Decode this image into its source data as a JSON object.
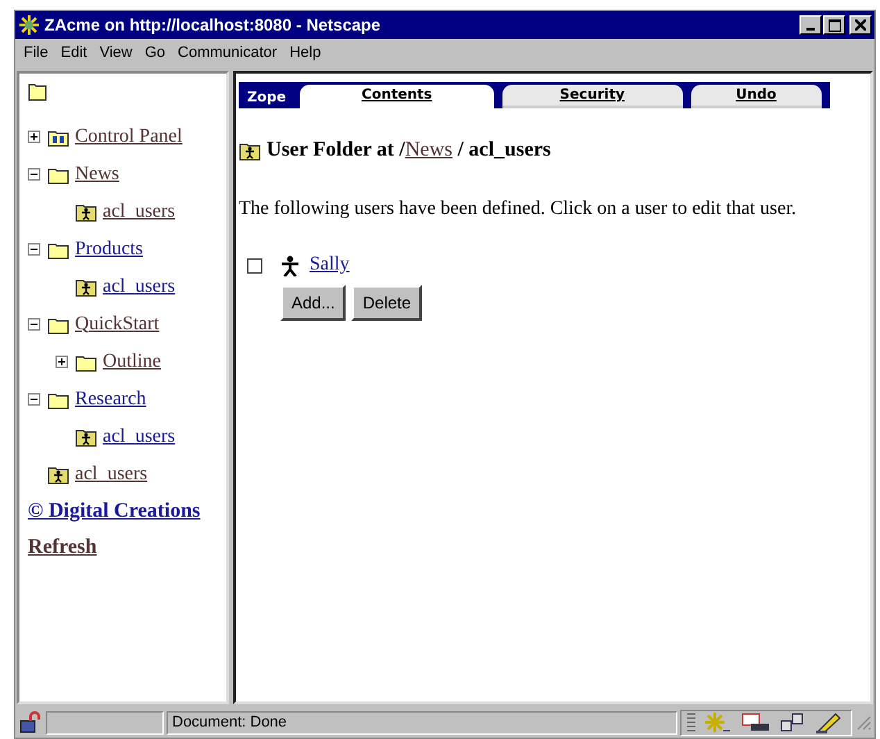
{
  "window": {
    "title": "ZAcme on http://localhost:8080 - Netscape"
  },
  "menu": [
    "File",
    "Edit",
    "View",
    "Go",
    "Communicator",
    "Help"
  ],
  "tree": [
    {
      "label": "Control Panel",
      "kind": "control_panel",
      "expanded": false,
      "visited": true
    },
    {
      "label": "News",
      "kind": "folder",
      "expanded": true,
      "visited": true,
      "children": [
        {
          "label": "acl_users",
          "kind": "user_folder",
          "visited": true
        }
      ]
    },
    {
      "label": "Products",
      "kind": "folder",
      "expanded": true,
      "visited": false,
      "children": [
        {
          "label": "acl_users",
          "kind": "user_folder",
          "visited": false
        }
      ]
    },
    {
      "label": "QuickStart",
      "kind": "folder",
      "expanded": true,
      "visited": true,
      "children": [
        {
          "label": "Outline",
          "kind": "folder",
          "expanded": false,
          "visited": true
        }
      ]
    },
    {
      "label": "Research",
      "kind": "folder",
      "expanded": true,
      "visited": false,
      "children": [
        {
          "label": "acl_users",
          "kind": "user_folder",
          "visited": false
        }
      ]
    },
    {
      "label": "acl_users",
      "kind": "user_folder",
      "visited": true
    }
  ],
  "sidebar_links": [
    {
      "label": "© Digital Creations",
      "visited": false
    },
    {
      "label": "Refresh",
      "visited": true
    }
  ],
  "tab_bar": {
    "label": "Zope",
    "tabs": [
      {
        "label": "Contents",
        "selected": true
      },
      {
        "label": "Security",
        "selected": false
      },
      {
        "label": "Undo",
        "selected": false
      }
    ]
  },
  "heading": {
    "prefix": "User Folder at /",
    "link": "News",
    "suffix": " / acl_users"
  },
  "description": "The following users have been defined. Click on a user to edit that user.",
  "users": [
    {
      "name": "Sally",
      "checked": false
    }
  ],
  "buttons": [
    "Add...",
    "Delete"
  ],
  "status_bar": {
    "text": "Document: Done"
  }
}
